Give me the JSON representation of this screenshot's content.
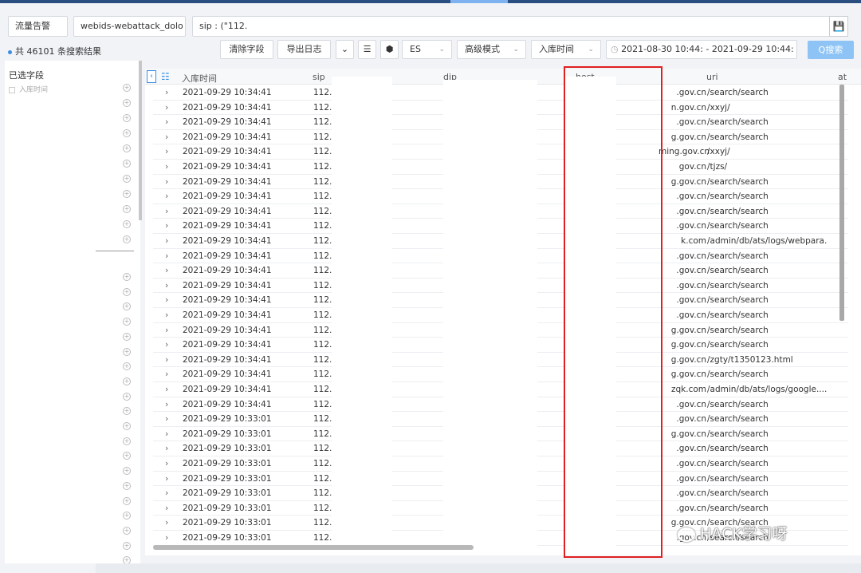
{
  "toolbar": {
    "category_select": "流量告警",
    "index_select": "webids-webattack_dolo",
    "query": "sip : (\"112.",
    "clear_fields": "清除字段",
    "export_log": "导出日志",
    "engine_select": "ES",
    "mode_select": "高级模式",
    "time_field_select": "入库时间",
    "time_range": "2021-08-30 10:44: - 2021-09-29 10:44:",
    "search_button": "Q搜索"
  },
  "summary": "共 46101 条搜索结果",
  "left_panel": {
    "title": "已选字段",
    "selected_field": "入库时间"
  },
  "columns": [
    "入库时间",
    "sip",
    "dip",
    "host",
    "uri",
    "at"
  ],
  "rows": [
    {
      "time": "2021-09-29 10:34:41",
      "sip": "112.",
      "host": ".gov.cn",
      "uri": "/search/search"
    },
    {
      "time": "2021-09-29 10:34:41",
      "sip": "112.",
      "host": "n.gov.cn",
      "uri": "/xxyj/"
    },
    {
      "time": "2021-09-29 10:34:41",
      "sip": "112.",
      "host": ".gov.cn",
      "uri": "/search/search"
    },
    {
      "time": "2021-09-29 10:34:41",
      "sip": "112.",
      "host": "g.gov.cn",
      "uri": "/search/search"
    },
    {
      "time": "2021-09-29 10:34:41",
      "sip": "112.",
      "host": "ming.gov.cn",
      "uri": "/xxyj/"
    },
    {
      "time": "2021-09-29 10:34:41",
      "sip": "112.",
      "host": "gov.cn",
      "uri": "/tjzs/"
    },
    {
      "time": "2021-09-29 10:34:41",
      "sip": "112.",
      "host": "g.gov.cn",
      "uri": "/search/search"
    },
    {
      "time": "2021-09-29 10:34:41",
      "sip": "112.",
      "host": ".gov.cn",
      "uri": "/search/search"
    },
    {
      "time": "2021-09-29 10:34:41",
      "sip": "112.",
      "host": ".gov.cn",
      "uri": "/search/search"
    },
    {
      "time": "2021-09-29 10:34:41",
      "sip": "112.",
      "host": ".gov.cn",
      "uri": "/search/search"
    },
    {
      "time": "2021-09-29 10:34:41",
      "sip": "112.",
      "host": "k.com",
      "uri": "/admin/db/ats/logs/webpara..."
    },
    {
      "time": "2021-09-29 10:34:41",
      "sip": "112.",
      "host": ".gov.cn",
      "uri": "/search/search"
    },
    {
      "time": "2021-09-29 10:34:41",
      "sip": "112.",
      "host": ".gov.cn",
      "uri": "/search/search"
    },
    {
      "time": "2021-09-29 10:34:41",
      "sip": "112.",
      "host": ".gov.cn",
      "uri": "/search/search"
    },
    {
      "time": "2021-09-29 10:34:41",
      "sip": "112.",
      "host": ".gov.cn",
      "uri": "/search/search"
    },
    {
      "time": "2021-09-29 10:34:41",
      "sip": "112.",
      "host": ".gov.cn",
      "uri": "/search/search"
    },
    {
      "time": "2021-09-29 10:34:41",
      "sip": "112.",
      "host": "g.gov.cn",
      "uri": "/search/search"
    },
    {
      "time": "2021-09-29 10:34:41",
      "sip": "112.",
      "host": "g.gov.cn",
      "uri": "/search/search"
    },
    {
      "time": "2021-09-29 10:34:41",
      "sip": "112.",
      "host": "g.gov.cn",
      "uri": "/zgty/t1350123.html"
    },
    {
      "time": "2021-09-29 10:34:41",
      "sip": "112.",
      "host": "g.gov.cn",
      "uri": "/search/search"
    },
    {
      "time": "2021-09-29 10:34:41",
      "sip": "112.",
      "host": "zqk.com",
      "uri": "/admin/db/ats/logs/google...."
    },
    {
      "time": "2021-09-29 10:34:41",
      "sip": "112.",
      "host": ".gov.cn",
      "uri": "/search/search"
    },
    {
      "time": "2021-09-29 10:33:01",
      "sip": "112.",
      "host": ".gov.cn",
      "uri": "/search/search"
    },
    {
      "time": "2021-09-29 10:33:01",
      "sip": "112.",
      "host": "g.gov.cn",
      "uri": "/search/search"
    },
    {
      "time": "2021-09-29 10:33:01",
      "sip": "112.",
      "host": ".gov.cn",
      "uri": "/search/search"
    },
    {
      "time": "2021-09-29 10:33:01",
      "sip": "112.",
      "host": ".gov.cn",
      "uri": "/search/search"
    },
    {
      "time": "2021-09-29 10:33:01",
      "sip": "112.",
      "host": ".gov.cn",
      "uri": "/search/search"
    },
    {
      "time": "2021-09-29 10:33:01",
      "sip": "112.",
      "host": ".gov.cn",
      "uri": "/search/search"
    },
    {
      "time": "2021-09-29 10:33:01",
      "sip": "112.",
      "host": ".gov.cn",
      "uri": "/search/search"
    },
    {
      "time": "2021-09-29 10:33:01",
      "sip": "112.",
      "host": "g.gov.cn",
      "uri": "/search/search"
    },
    {
      "time": "2021-09-29 10:33:01",
      "sip": "112.",
      "host": ".gov.cn",
      "uri": "/search/search"
    }
  ],
  "watermark": "HACK学习呀",
  "colors": {
    "accent": "#3a8ee6",
    "highlight_box": "#e02020",
    "search_button": "#8ec4f5"
  }
}
